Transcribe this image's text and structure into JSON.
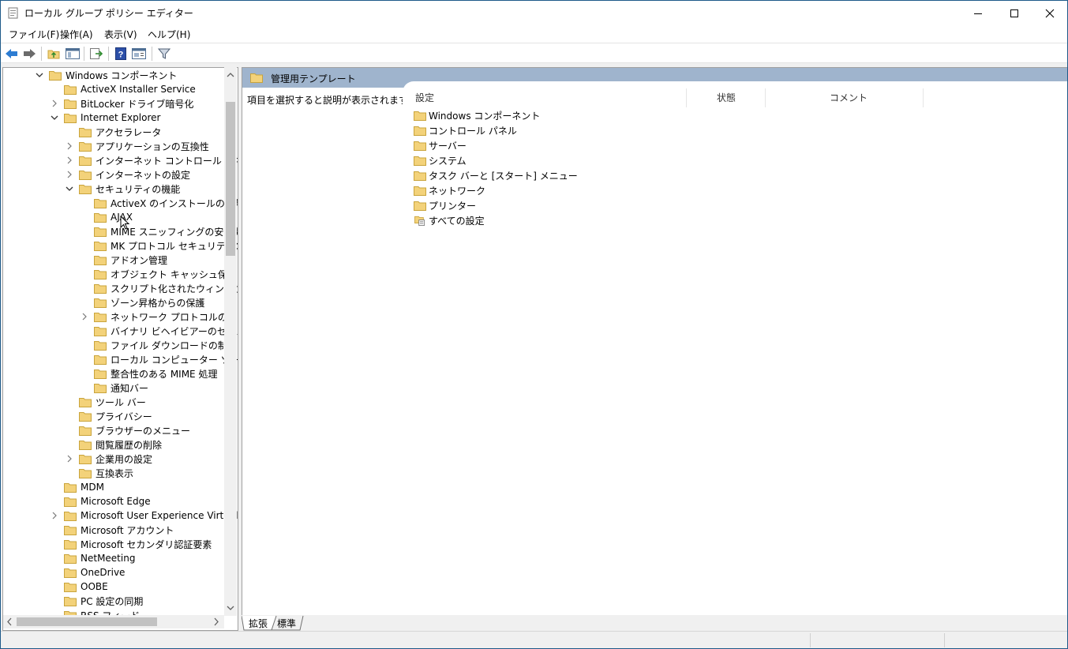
{
  "window": {
    "title": "ローカル グループ ポリシー エディター",
    "minimize": "minimize-button",
    "maximize": "maximize-button",
    "close": "close-button"
  },
  "menu": [
    "ファイル(F)",
    "操作(A)",
    "表示(V)",
    "ヘルプ(H)"
  ],
  "toolbar": [
    "back-icon",
    "forward-icon",
    "up-folder-icon",
    "show-hide-tree-icon",
    "export-list-icon",
    "help-icon",
    "properties-icon",
    "filter-icon"
  ],
  "tree": [
    {
      "label": "Windows コンポーネント",
      "expander": "open"
    },
    {
      "label": "ActiveX Installer Service",
      "expander": "none"
    },
    {
      "label": "BitLocker ドライブ暗号化",
      "expander": "closed"
    },
    {
      "label": "Internet Explorer",
      "expander": "open"
    },
    {
      "label": "アクセラレータ",
      "expander": "none"
    },
    {
      "label": "アプリケーションの互換性",
      "expander": "closed"
    },
    {
      "label": "インターネット コントロール パネル",
      "expander": "closed"
    },
    {
      "label": "インターネットの設定",
      "expander": "closed"
    },
    {
      "label": "セキュリティの機能",
      "expander": "open"
    },
    {
      "label": "ActiveX のインストールの制限",
      "expander": "none"
    },
    {
      "label": "AJAX",
      "expander": "none"
    },
    {
      "label": "MIME スニッフィングの安全機能",
      "expander": "none"
    },
    {
      "label": "MK プロトコル セキュリティの制限",
      "expander": "none"
    },
    {
      "label": "アドオン管理",
      "expander": "none"
    },
    {
      "label": "オブジェクト キャッシュ保護",
      "expander": "none"
    },
    {
      "label": "スクリプト化されたウィンドウのセキュリティ制限",
      "expander": "none"
    },
    {
      "label": "ゾーン昇格からの保護",
      "expander": "none"
    },
    {
      "label": "ネットワーク プロトコルのロックダウン",
      "expander": "closed"
    },
    {
      "label": "バイナリ ビヘイビアーのセキュリティ制限",
      "expander": "none"
    },
    {
      "label": "ファイル ダウンロードの制限",
      "expander": "none"
    },
    {
      "label": "ローカル コンピューター ゾーンのロックダウン",
      "expander": "none"
    },
    {
      "label": "整合性のある MIME 処理",
      "expander": "none"
    },
    {
      "label": "通知バー",
      "expander": "none"
    },
    {
      "label": "ツール バー",
      "expander": "none"
    },
    {
      "label": "プライバシー",
      "expander": "none"
    },
    {
      "label": "ブラウザーのメニュー",
      "expander": "none"
    },
    {
      "label": "閲覧履歴の削除",
      "expander": "none"
    },
    {
      "label": "企業用の設定",
      "expander": "closed"
    },
    {
      "label": "互換表示",
      "expander": "none"
    },
    {
      "label": "MDM",
      "expander": "none"
    },
    {
      "label": "Microsoft Edge",
      "expander": "none"
    },
    {
      "label": "Microsoft User Experience Virtualization",
      "expander": "closed"
    },
    {
      "label": "Microsoft アカウント",
      "expander": "none"
    },
    {
      "label": "Microsoft セカンダリ認証要素",
      "expander": "none"
    },
    {
      "label": "NetMeeting",
      "expander": "none"
    },
    {
      "label": "OneDrive",
      "expander": "none"
    },
    {
      "label": "OOBE",
      "expander": "none"
    },
    {
      "label": "PC 設定の同期",
      "expander": "none"
    },
    {
      "label": "RSS フィード",
      "expander": "none"
    }
  ],
  "right": {
    "header": "管理用テンプレート",
    "description": "項目を選択すると説明が表示されます。",
    "columns": [
      "設定",
      "状態",
      "コメント"
    ],
    "items": [
      {
        "label": "Windows コンポーネント",
        "icon": "folder-icon"
      },
      {
        "label": "コントロール パネル",
        "icon": "folder-icon"
      },
      {
        "label": "サーバー",
        "icon": "folder-icon"
      },
      {
        "label": "システム",
        "icon": "folder-icon"
      },
      {
        "label": "タスク バーと [スタート] メニュー",
        "icon": "folder-icon"
      },
      {
        "label": "ネットワーク",
        "icon": "folder-icon"
      },
      {
        "label": "プリンター",
        "icon": "folder-icon"
      },
      {
        "label": "すべての設定",
        "icon": "all-settings-icon"
      }
    ]
  },
  "tabs": [
    "拡張",
    "標準"
  ],
  "colors": {
    "folder": "#f3d27a",
    "header_band": "#9fb4cd",
    "border": "#a0a0a0"
  }
}
